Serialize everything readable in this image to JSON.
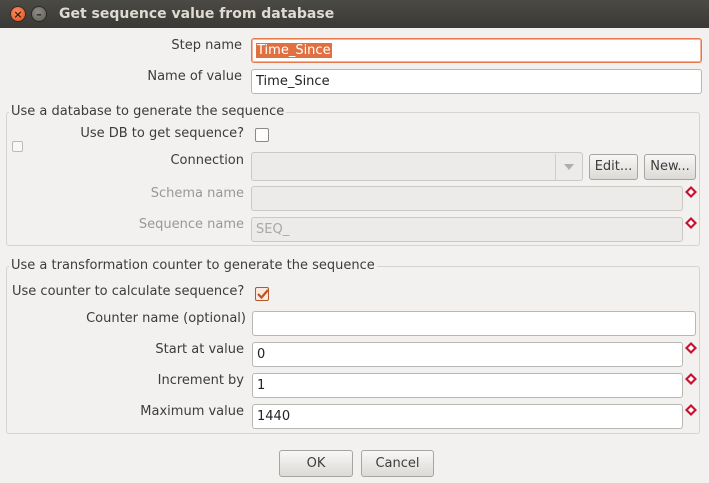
{
  "window": {
    "title": "Get sequence value from database"
  },
  "fields": {
    "step_name": {
      "label": "Step name",
      "value": "Time_Since"
    },
    "name_of_value": {
      "label": "Name of value",
      "value": "Time_Since"
    }
  },
  "db_group": {
    "title": "Use a database to generate the sequence",
    "use_db_label": "Use DB to get sequence?",
    "connection_label": "Connection",
    "edit_button": "Edit...",
    "new_button": "New...",
    "schema_label": "Schema name",
    "sequence_label": "Sequence name",
    "sequence_value": "SEQ_"
  },
  "counter_group": {
    "title": "Use a transformation counter to generate the sequence",
    "use_counter_label": "Use counter to calculate sequence?",
    "counter_name_label": "Counter name (optional)",
    "start_label": "Start at value",
    "start_value": "0",
    "increment_label": "Increment by",
    "increment_value": "1",
    "max_label": "Maximum value",
    "max_value": "1440"
  },
  "buttons": {
    "ok": "OK",
    "cancel": "Cancel"
  },
  "icons": [
    "close-icon",
    "minimize-icon",
    "dropdown-arrow-icon",
    "variable-diamond-icon",
    "checkmark-icon"
  ],
  "colors": {
    "focus_border": "#e8784a",
    "selection": "#e07040",
    "titlebar": "#3c3b37"
  }
}
